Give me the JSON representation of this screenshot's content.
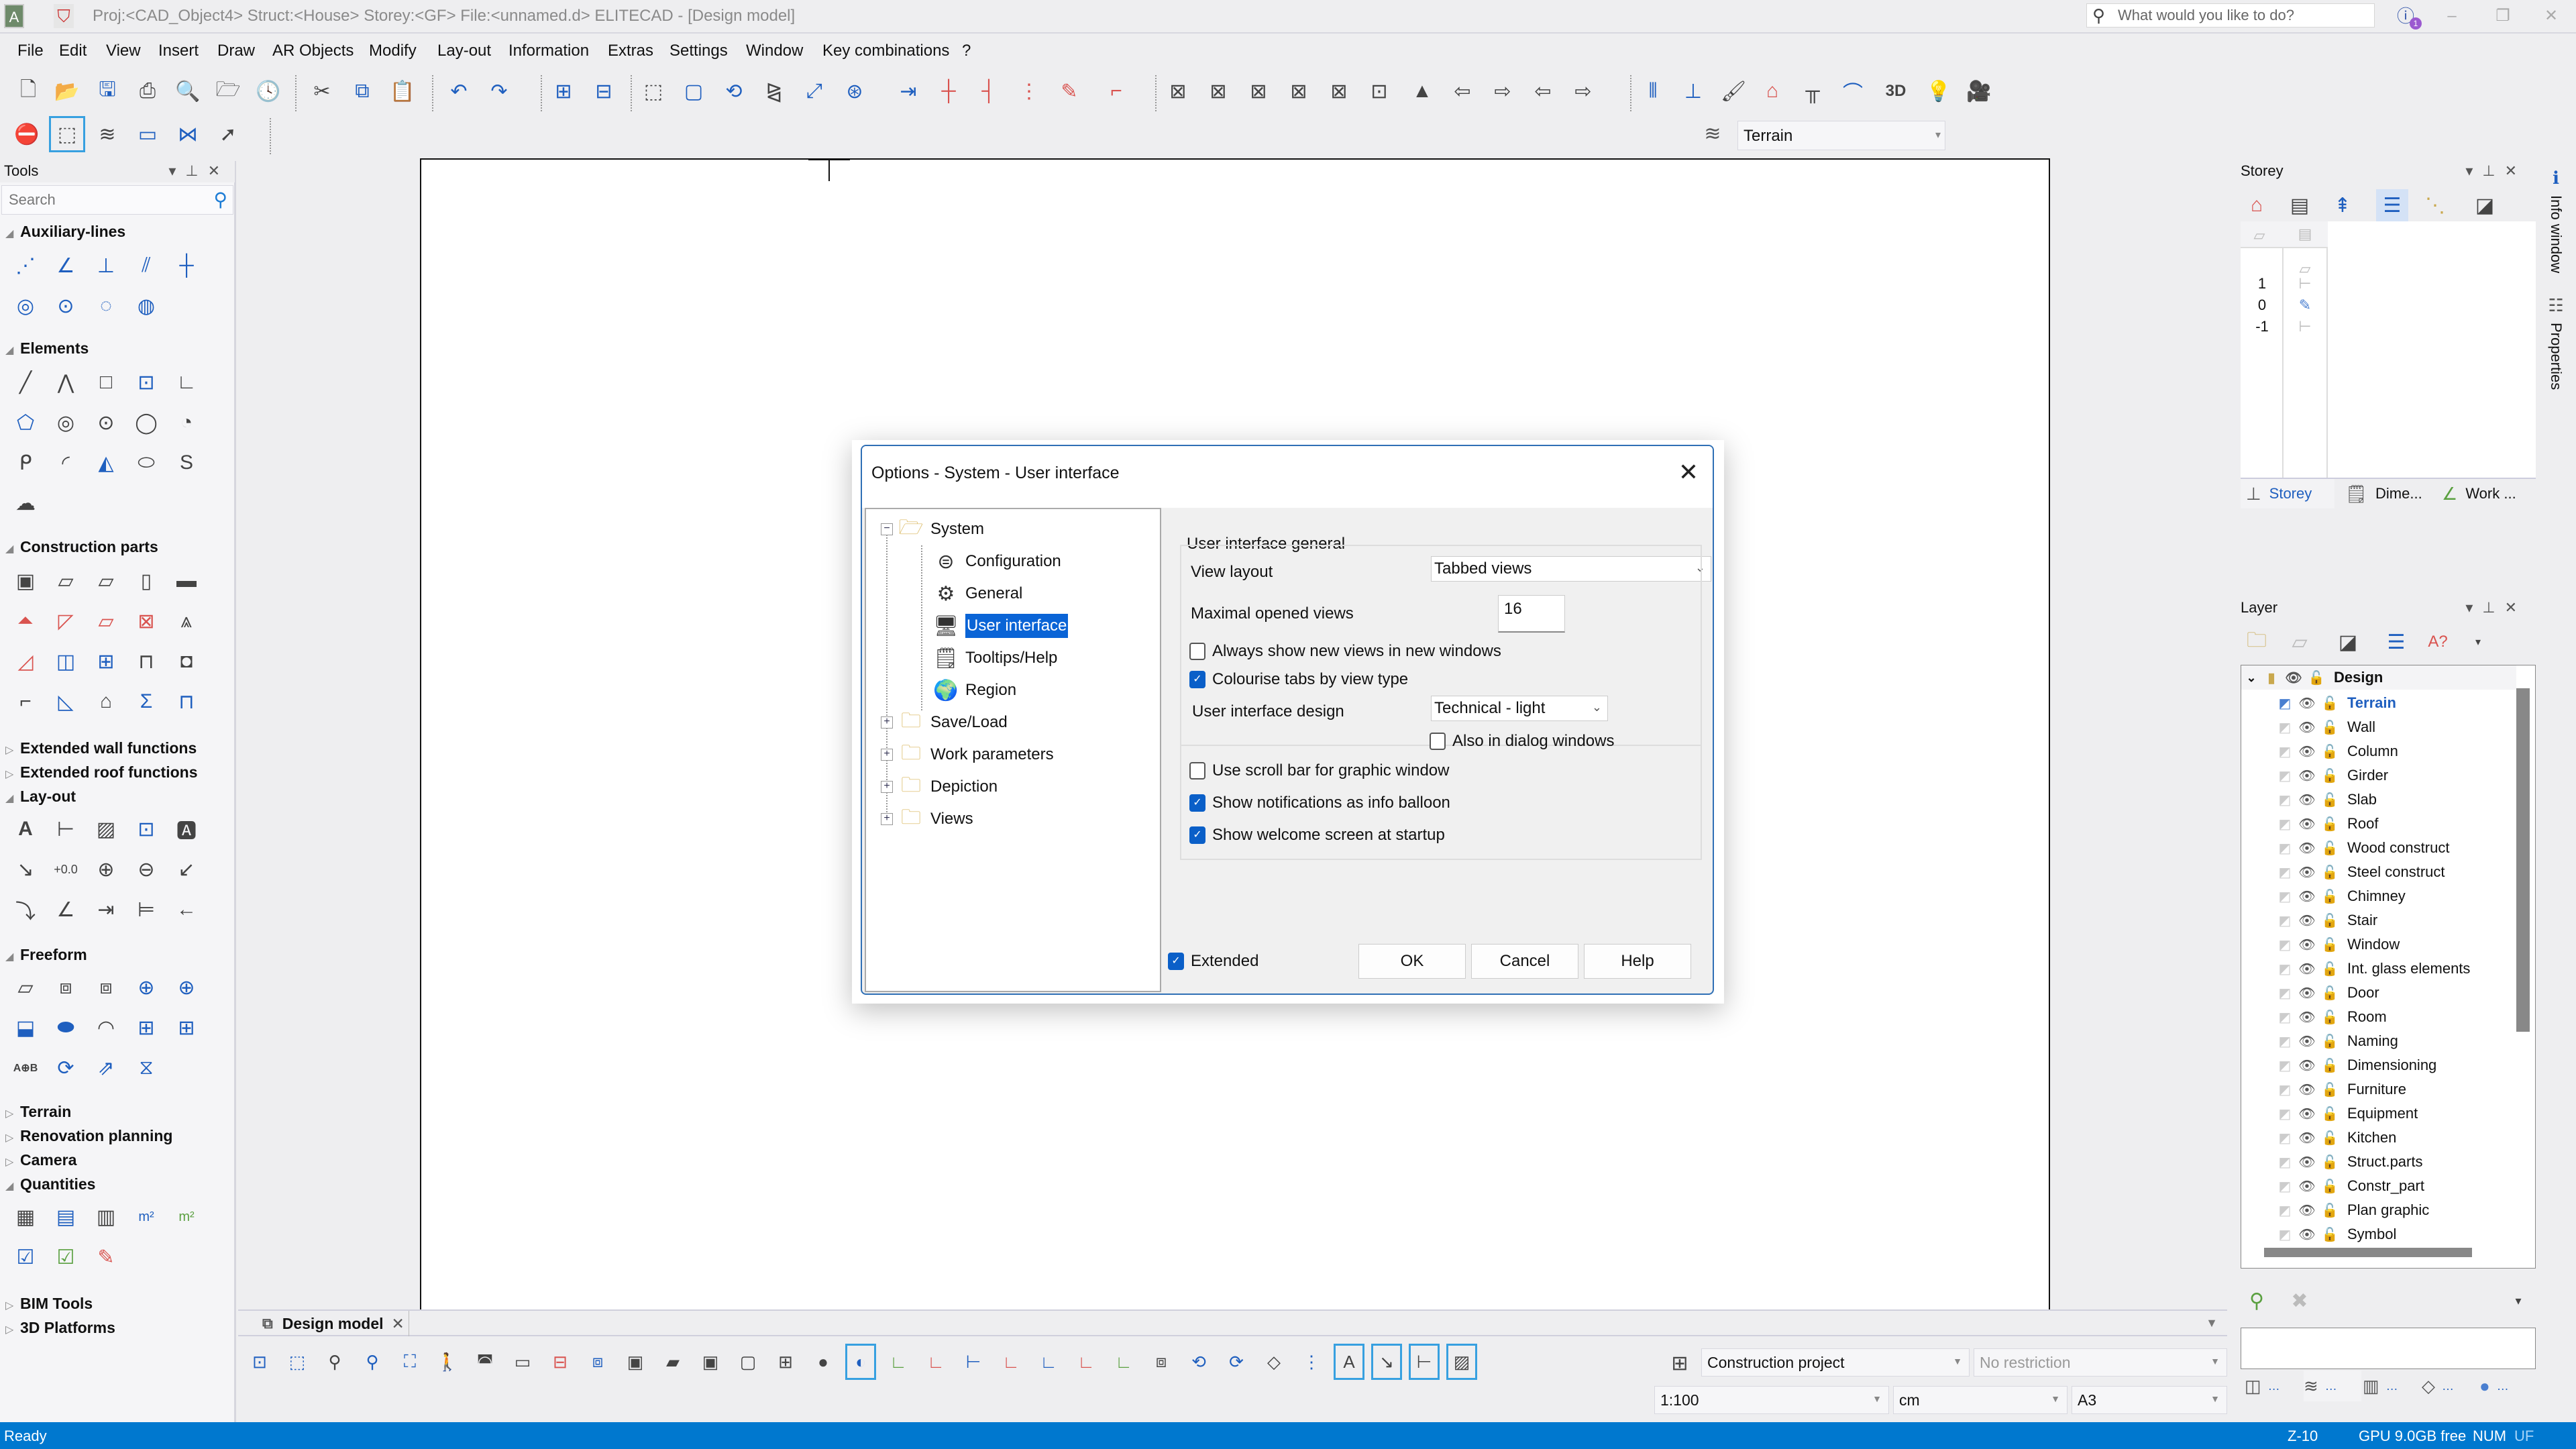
{
  "window": {
    "title": "Proj:<CAD_Object4> Struct:<House>  Storey:<GF>  File:<unnamed.d> ELITECAD - [Design model]",
    "search_placeholder": "What would you like to do?",
    "info_badge_count": "1",
    "app_icon_label": "A"
  },
  "menu": [
    "File",
    "Edit",
    "View",
    "Insert",
    "Draw",
    "AR Objects",
    "Modify",
    "Lay-out",
    "Information",
    "Extras",
    "Settings",
    "Window",
    "Key combinations",
    "?"
  ],
  "toolbar": {
    "layer_combo_value": "Terrain",
    "row1_icons": [
      "new-file-icon",
      "open-icon",
      "save-icon",
      "print-icon",
      "print-preview-icon",
      "open-recent-icon",
      "save-history-icon",
      "cut-icon",
      "copy-icon",
      "paste-icon",
      "undo-icon",
      "redo-icon",
      "zoom-in-icon",
      "zoom-out-icon",
      "select-copy-icon",
      "select-icon",
      "rotate-icon",
      "mirror-icon",
      "stretch-icon",
      "scale-icon",
      "move-icon",
      "trim-icon",
      "extend-icon",
      "divide-icon",
      "erase-icon",
      "edit-line-icon",
      "view-x-icon",
      "view-x-2-icon",
      "view-x-3-icon",
      "view-x-4-icon",
      "view-x-5-icon",
      "view-x-6-icon",
      "perspective-icon",
      "prev-view-icon",
      "next-view-icon",
      "prev-camera-icon",
      "next-camera-icon",
      "storey-stack-icon",
      "elevate-icon",
      "paint-icon",
      "roof-rotate-icon",
      "column-icon",
      "arc-icon",
      "3d-icon",
      "light-icon",
      "camera-icon"
    ],
    "row2_icons": [
      "cancel-icon",
      "window-select-icon",
      "layers-icon",
      "rectangle-icon",
      "node-edit-icon",
      "pointer-zoom-icon"
    ]
  },
  "tools_panel": {
    "title": "Tools",
    "search_placeholder": "Search",
    "sections": [
      {
        "label": "Auxiliary-lines",
        "expanded": true,
        "icons": [
          "aux-line-2pt",
          "aux-line-angle",
          "aux-line-perp",
          "aux-line-parallel-n",
          "aux-cross",
          "aux-circle-radius",
          "aux-circle-center",
          "aux-circle-3pt",
          "aux-circle-tangent"
        ]
      },
      {
        "label": "Elements",
        "expanded": true,
        "icons": [
          "line",
          "polyline",
          "rectangle",
          "rectangle-grid",
          "offset-polyline",
          "polygon",
          "concentric-circle",
          "circle-center",
          "circle-3pt",
          "circle-tangent",
          "contour",
          "arc",
          "arc-angle",
          "ellipse",
          "spline",
          "cloud"
        ]
      },
      {
        "label": "Construction parts",
        "expanded": true,
        "icons": [
          "wall",
          "slab",
          "slab-opening",
          "column",
          "girder",
          "roof",
          "roof-window",
          "roof-opening",
          "dormer",
          "roof-truss",
          "chimney",
          "window",
          "curtain-wall",
          "door",
          "niche",
          "stair",
          "stair-railing",
          "room",
          "room-sum",
          "room-line"
        ]
      },
      {
        "label": "Extended wall functions",
        "expanded": false
      },
      {
        "label": "Extended roof functions",
        "expanded": false
      },
      {
        "label": "Lay-out",
        "expanded": true,
        "icons": [
          "text",
          "dimension",
          "hatch",
          "symbol",
          "label",
          "leader",
          "level-mark",
          "elevation-point",
          "diameter",
          "radius",
          "arc-dimension",
          "angle-dimension",
          "single-dimension",
          "chain-dimension",
          "arrow"
        ]
      },
      {
        "label": "Freeform",
        "expanded": true,
        "icons": [
          "surface",
          "extrude",
          "extrude-2",
          "revolve",
          "revolve-2",
          "sweep",
          "sweep-pipe",
          "curved-surface",
          "section-box",
          "section-cut",
          "boolean",
          "rotate-3d",
          "move-3d",
          "mirror-3d"
        ]
      },
      {
        "label": "Terrain",
        "expanded": false
      },
      {
        "label": "Renovation planning",
        "expanded": false
      },
      {
        "label": "Camera",
        "expanded": false
      },
      {
        "label": "Quantities",
        "expanded": true,
        "icons": [
          "calculator",
          "report-db",
          "report",
          "room-area",
          "room-area-2",
          "room-check",
          "room-check-2",
          "room-edit"
        ]
      },
      {
        "label": "BIM Tools",
        "expanded": false
      },
      {
        "label": "3D Platforms",
        "expanded": false
      }
    ]
  },
  "dialog": {
    "title": "Options - System - User interface",
    "tree": [
      {
        "label": "System",
        "level": 0,
        "expanded": true,
        "icon": "folder-open-icon"
      },
      {
        "label": "Configuration",
        "level": 1,
        "icon": "configuration-icon"
      },
      {
        "label": "General",
        "level": 1,
        "icon": "gear-icon"
      },
      {
        "label": "User interface",
        "level": 1,
        "icon": "monitor-icon",
        "selected": true
      },
      {
        "label": "Tooltips/Help",
        "level": 1,
        "icon": "tooltip-icon"
      },
      {
        "label": "Region",
        "level": 1,
        "icon": "globe-icon"
      },
      {
        "label": "Save/Load",
        "level": 0,
        "expanded": false,
        "icon": "folder-icon"
      },
      {
        "label": "Work parameters",
        "level": 0,
        "expanded": false,
        "icon": "folder-icon"
      },
      {
        "label": "Depiction",
        "level": 0,
        "expanded": false,
        "icon": "folder-icon"
      },
      {
        "label": "Views",
        "level": 0,
        "expanded": false,
        "icon": "folder-icon"
      }
    ],
    "group_title": "User interface general",
    "view_layout_label": "View layout",
    "view_layout_value": "Tabbed views",
    "max_views_label": "Maximal opened views",
    "max_views_value": "16",
    "always_new_windows": {
      "label": "Always show new views in new windows",
      "checked": false
    },
    "colourise_tabs": {
      "label": "Colourise tabs by view type",
      "checked": true
    },
    "design_label": "User interface design",
    "design_value": "Technical - light",
    "also_dialogs": {
      "label": "Also in dialog windows",
      "checked": false
    },
    "scroll_bar": {
      "label": "Use scroll bar for graphic window",
      "checked": false
    },
    "notifications": {
      "label": "Show notifications as info balloon",
      "checked": true
    },
    "welcome": {
      "label": "Show welcome screen at startup",
      "checked": true
    },
    "extended": {
      "label": "Extended",
      "checked": true
    },
    "ok_label": "OK",
    "cancel_label": "Cancel",
    "help_label": "Help"
  },
  "storey_panel": {
    "title": "Storey",
    "storeys": [
      {
        "number": "1",
        "active": false
      },
      {
        "number": "0",
        "active": true
      },
      {
        "number": "-1",
        "active": false
      }
    ],
    "tabs": [
      {
        "label": "Storey",
        "active": true
      },
      {
        "label": "Dime...",
        "active": false
      },
      {
        "label": "Work ...",
        "active": false
      }
    ]
  },
  "side_tabs": [
    "Info window",
    "Properties"
  ],
  "layer_panel": {
    "title": "Layer",
    "root": "Design",
    "active_layer": "Terrain",
    "layers": [
      "Terrain",
      "Wall",
      "Column",
      "Girder",
      "Slab",
      "Roof",
      "Wood construct",
      "Steel construct",
      "Chimney",
      "Stair",
      "Window",
      "Int. glass elements",
      "Door",
      "Room",
      "Naming",
      "Dimensioning",
      "Furniture",
      "Equipment",
      "Kitchen",
      "Struct.parts",
      "Constr_part",
      "Plan graphic",
      "Symbol"
    ]
  },
  "view_tab": {
    "label": "Design model"
  },
  "bottom_bar": {
    "project_type": "Construction project",
    "restriction": "No restriction",
    "scale": "1:100",
    "unit": "cm",
    "paper": "A3"
  },
  "status": {
    "left": "Ready",
    "zoom": "Z-10",
    "gpu": "GPU 9.0GB free",
    "num": "NUM",
    "uf": "UF"
  },
  "colors": {
    "accent": "#0078cf",
    "selection": "#0a64d6",
    "checkbox": "#0a5fc8",
    "active_layer": "#1f5fbf"
  }
}
